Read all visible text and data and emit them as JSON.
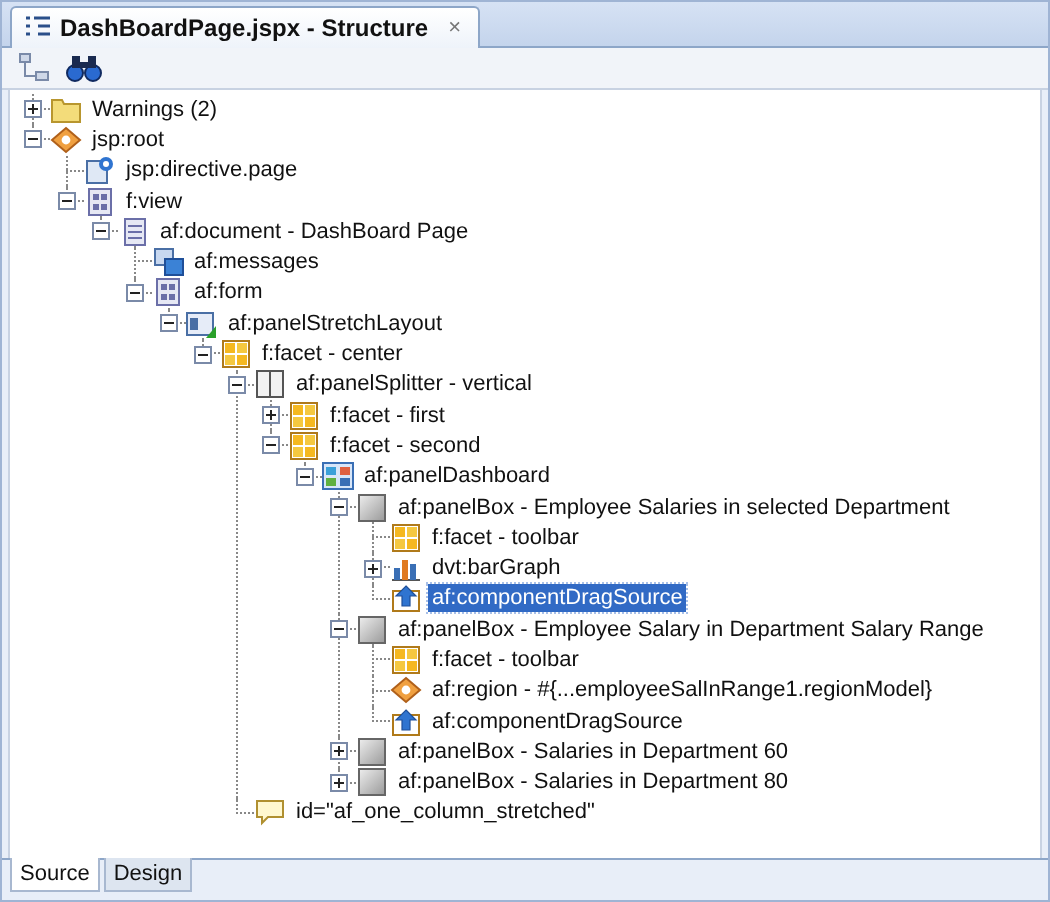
{
  "tabs": [
    {
      "label": "DashBoardPage.jspx - Structure",
      "close": "×",
      "selected": true
    }
  ],
  "tree": [
    {
      "label": "Warnings (2)",
      "kind": "folder",
      "expanded": false,
      "selected": false
    },
    {
      "label": "jsp:root",
      "kind": "tag",
      "expanded": true,
      "selected": false,
      "children": [
        {
          "label": "jsp:directive.page",
          "kind": "directive",
          "selected": false
        },
        {
          "label": "f:view",
          "kind": "view",
          "expanded": true,
          "selected": false,
          "children": [
            {
              "label": "af:document - DashBoard Page",
              "kind": "document",
              "expanded": true,
              "selected": false,
              "children": [
                {
                  "label": "af:messages",
                  "kind": "messages",
                  "selected": false
                },
                {
                  "label": "af:form",
                  "kind": "view",
                  "expanded": true,
                  "selected": false,
                  "children": [
                    {
                      "label": "af:panelStretchLayout",
                      "kind": "layout",
                      "expanded": true,
                      "selected": false,
                      "children": [
                        {
                          "label": "f:facet - center",
                          "kind": "facet",
                          "expanded": true,
                          "selected": false,
                          "children": [
                            {
                              "label": "af:panelSplitter - vertical",
                              "kind": "splitter",
                              "expanded": true,
                              "selected": false,
                              "children": [
                                {
                                  "label": "f:facet - first",
                                  "kind": "facet",
                                  "expanded": false,
                                  "selected": false
                                },
                                {
                                  "label": "f:facet - second",
                                  "kind": "facet",
                                  "expanded": true,
                                  "selected": false,
                                  "children": [
                                    {
                                      "label": "af:panelDashboard",
                                      "kind": "dashboard",
                                      "expanded": true,
                                      "selected": false,
                                      "children": [
                                        {
                                          "label": "af:panelBox - Employee Salaries in selected Department",
                                          "kind": "panelbox",
                                          "expanded": true,
                                          "selected": false,
                                          "children": [
                                            {
                                              "label": "f:facet - toolbar",
                                              "kind": "facet",
                                              "selected": false
                                            },
                                            {
                                              "label": "dvt:barGraph",
                                              "kind": "graph",
                                              "expanded": false,
                                              "selected": false
                                            },
                                            {
                                              "label": "af:componentDragSource",
                                              "kind": "dragsource",
                                              "selected": true
                                            }
                                          ]
                                        },
                                        {
                                          "label": "af:panelBox - Employee Salary in Department Salary Range",
                                          "kind": "panelbox",
                                          "expanded": true,
                                          "selected": false,
                                          "children": [
                                            {
                                              "label": "f:facet - toolbar",
                                              "kind": "facet",
                                              "selected": false
                                            },
                                            {
                                              "label": "af:region - #{...employeeSalInRange1.regionModel}",
                                              "kind": "tag",
                                              "selected": false
                                            },
                                            {
                                              "label": "af:componentDragSource",
                                              "kind": "dragsource",
                                              "selected": false
                                            }
                                          ]
                                        },
                                        {
                                          "label": "af:panelBox - Salaries in Department 60",
                                          "kind": "panelbox",
                                          "expanded": false,
                                          "selected": false
                                        },
                                        {
                                          "label": "af:panelBox - Salaries in Department 80",
                                          "kind": "panelbox",
                                          "expanded": false,
                                          "selected": false
                                        }
                                      ]
                                    }
                                  ]
                                }
                              ]
                            },
                            {
                              "label": "id=\"af_one_column_stretched\"",
                              "kind": "comment",
                              "selected": false
                            }
                          ]
                        }
                      ]
                    }
                  ]
                }
              ]
            }
          ]
        }
      ]
    }
  ],
  "bottom_tabs": [
    {
      "label": "Source",
      "selected": true
    },
    {
      "label": "Design",
      "selected": false
    }
  ]
}
